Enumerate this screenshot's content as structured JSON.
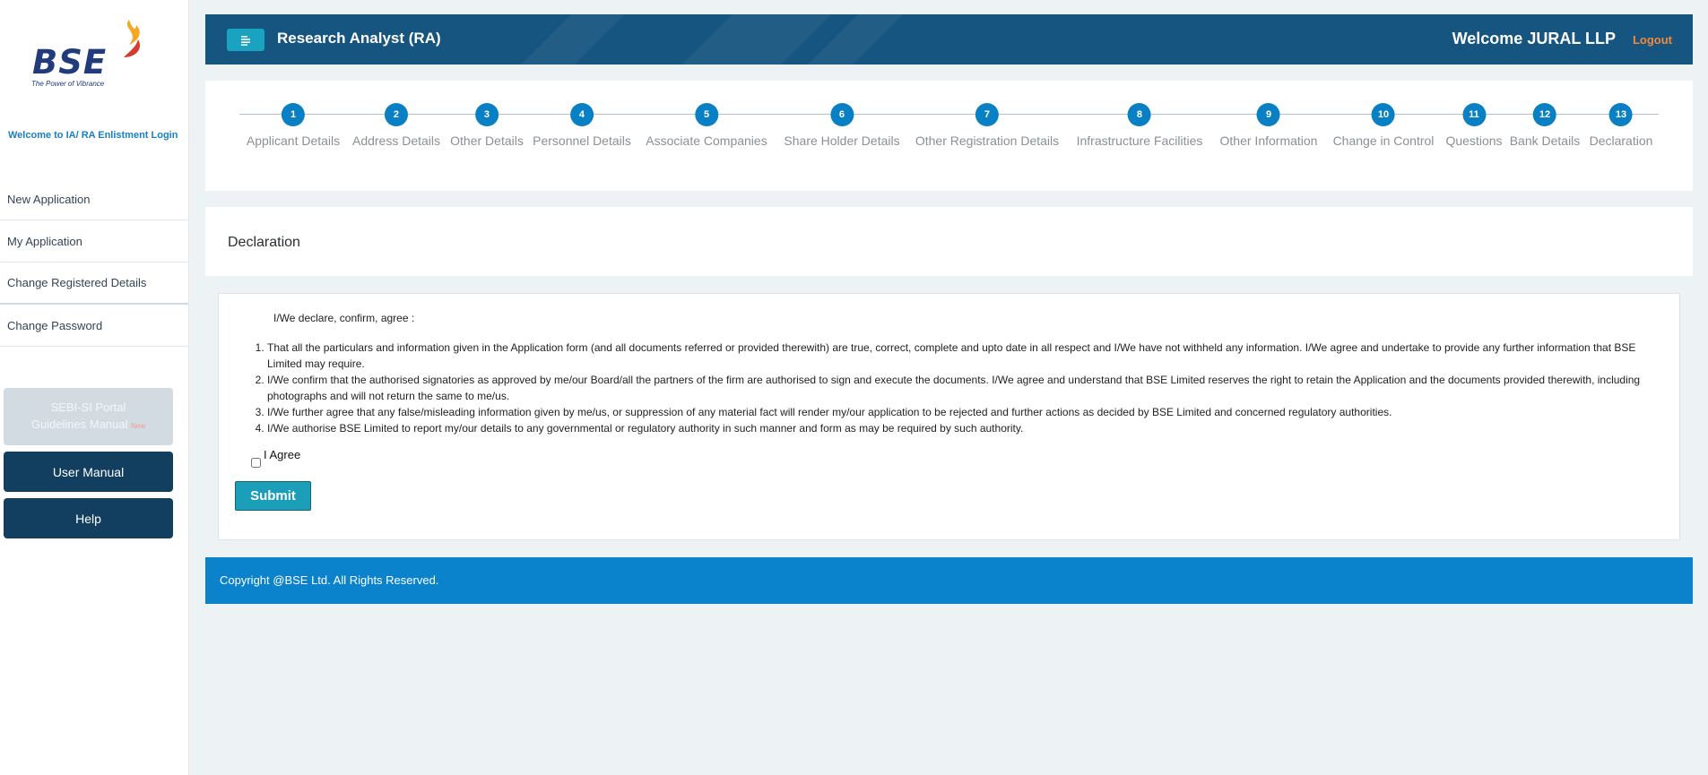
{
  "sidebar": {
    "logo_text": "BSE",
    "logo_tagline": "The Power of Vibrance",
    "welcome": "Welcome to IA/ RA Enlistment Login",
    "menu": [
      {
        "label": "New Application"
      },
      {
        "label": "My Application"
      },
      {
        "label": "Change Registered Details"
      },
      {
        "label": "Change Password"
      }
    ],
    "sebi_button": {
      "line1": "SEBI-SI Portal",
      "line2": "Guidelines Manual",
      "tag": "New"
    },
    "user_manual": "User Manual",
    "help": "Help"
  },
  "header": {
    "title": "Research Analyst (RA)",
    "welcome": "Welcome JURAL LLP",
    "logout": "Logout",
    "colors": {
      "bar": "#16557f",
      "toggle": "#1aa3c0",
      "logout": "#f2883d"
    }
  },
  "steps": [
    {
      "num": "1",
      "label": "Applicant Details"
    },
    {
      "num": "2",
      "label": "Address Details"
    },
    {
      "num": "3",
      "label": "Other Details"
    },
    {
      "num": "4",
      "label": "Personnel Details"
    },
    {
      "num": "5",
      "label": "Associate Companies"
    },
    {
      "num": "6",
      "label": "Share Holder Details"
    },
    {
      "num": "7",
      "label": "Other Registration Details"
    },
    {
      "num": "8",
      "label": "Infrastructure Facilities"
    },
    {
      "num": "9",
      "label": "Other Information"
    },
    {
      "num": "10",
      "label": "Change in Control"
    },
    {
      "num": "11",
      "label": "Questions"
    },
    {
      "num": "12",
      "label": "Bank Details"
    },
    {
      "num": "13",
      "label": "Declaration"
    }
  ],
  "page_title": "Declaration",
  "declaration": {
    "intro": "I/We declare, confirm, agree :",
    "items": [
      "That all the particulars and information given in the Application form (and all documents referred or provided therewith) are true, correct, complete and upto date in all respect and I/We have not withheld any information. I/We agree and undertake to provide any further information that BSE Limited may require.",
      "I/We confirm that the authorised signatories as approved by me/our Board/all the partners of the firm are authorised to sign and execute the documents. I/We agree and understand that BSE Limited reserves the right to retain the Application and the documents provided therewith, including photographs and will not return the same to me/us.",
      "I/We further agree that any false/misleading information given by me/us, or suppression of any material fact will render my/our application to be rejected and further actions as decided by BSE Limited and concerned regulatory authorities.",
      "I/We authorise BSE Limited to report my/our details to any governmental or regulatory authority in such manner and form as may be required by such authority."
    ],
    "agree_label": "I Agree",
    "agree_checked": false,
    "submit_label": "Submit"
  },
  "footer": {
    "text": "Copyright @BSE Ltd. All Rights Reserved."
  }
}
